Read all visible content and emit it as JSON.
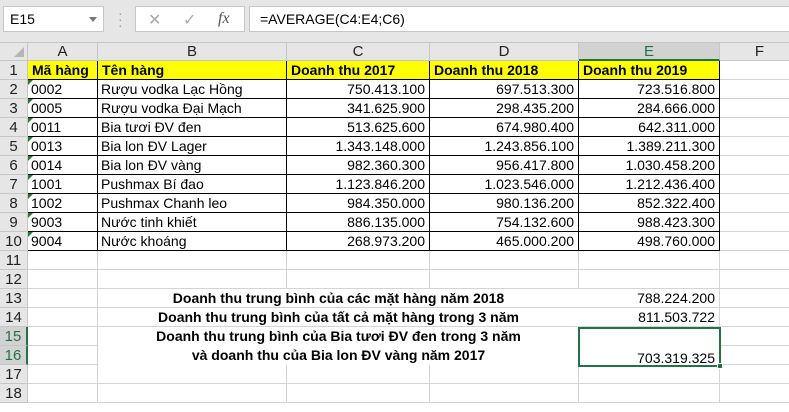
{
  "formula_bar": {
    "name_box": "E15",
    "cancel_icon": "✕",
    "enter_icon": "✓",
    "fx_label": "fx",
    "formula": "=AVERAGE(C4:E4;C6)"
  },
  "columns": [
    "A",
    "B",
    "C",
    "D",
    "E",
    "F"
  ],
  "selected_column": "E",
  "rows": [
    "1",
    "2",
    "3",
    "4",
    "5",
    "6",
    "7",
    "8",
    "9",
    "10",
    "11",
    "12",
    "13",
    "14",
    "15",
    "16",
    "17",
    "18"
  ],
  "table": {
    "headers": [
      "Mã hàng",
      "Tên hàng",
      "Doanh thu 2017",
      "Doanh thu 2018",
      "Doanh thu 2019"
    ],
    "data": [
      [
        "0002",
        "Rượu vodka Lạc Hồng",
        "750.413.100",
        "697.513.300",
        "723.516.800"
      ],
      [
        "0005",
        "Rượu vodka Đại Mạch",
        "341.625.900",
        "298.435.200",
        "284.666.000"
      ],
      [
        "0011",
        "Bia tươi ĐV đen",
        "513.625.600",
        "674.980.400",
        "642.311.000"
      ],
      [
        "0013",
        "Bia lon ĐV Lager",
        "1.343.148.000",
        "1.243.856.100",
        "1.389.211.300"
      ],
      [
        "0014",
        "Bia lon ĐV vàng",
        "982.360.300",
        "956.417.800",
        "1.030.458.200"
      ],
      [
        "1001",
        "Pushmax Bí đao",
        "1.123.846.200",
        "1.023.546.000",
        "1.212.436.400"
      ],
      [
        "1002",
        "Pushmax Chanh leo",
        "984.350.000",
        "980.136.200",
        "852.322.400"
      ],
      [
        "9003",
        "Nước tinh khiết",
        "886.135.000",
        "754.132.600",
        "988.423.300"
      ],
      [
        "9004",
        "Nước khoáng",
        "268.973.200",
        "465.000.200",
        "498.760.000"
      ]
    ]
  },
  "summary": {
    "row13_label": "Doanh thu trung bình của các mặt hàng năm 2018",
    "row13_value": "788.224.200",
    "row14_label": "Doanh thu trung bình của tất cả mặt hàng trong 3 năm",
    "row14_value": "811.503.722",
    "row15_label_line1": "Doanh thu trung bình của Bia tươi ĐV đen trong 3 năm",
    "row15_label_line2": "và doanh thu của Bia lon ĐV vàng năm 2017",
    "row15_value": "703.319.325"
  },
  "colors": {
    "accent": "#217346",
    "header_fill": "#ffff00"
  }
}
